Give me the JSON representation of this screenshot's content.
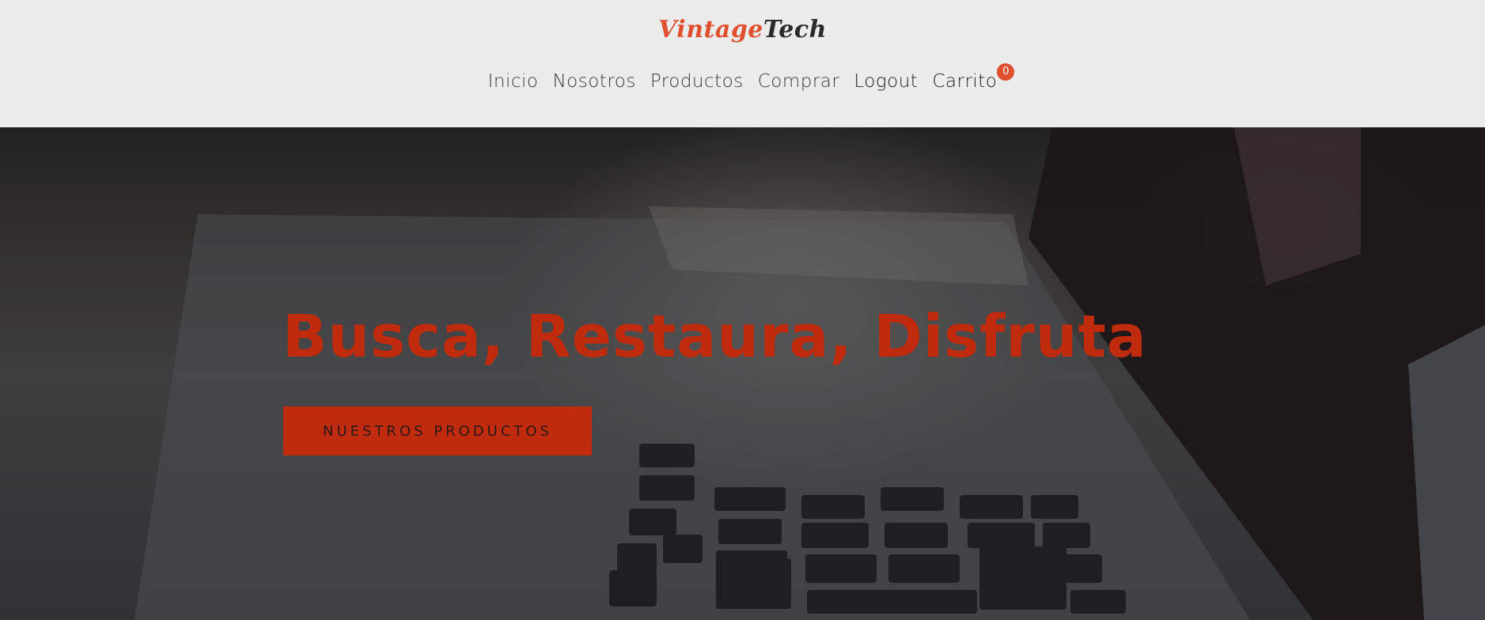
{
  "brand": {
    "part1": "Vintage",
    "part2": "Tech",
    "accent_color": "#e0502e"
  },
  "nav": {
    "items": [
      {
        "label": "Inicio"
      },
      {
        "label": "Nosotros"
      },
      {
        "label": "Productos"
      },
      {
        "label": "Comprar"
      },
      {
        "label": "Logout"
      },
      {
        "label": "Carrito"
      }
    ],
    "cart_count": "0"
  },
  "hero": {
    "title": "Busca, Restaura, Disfruta",
    "button_label": "NUESTROS PRODUCTOS",
    "title_color": "#c02a0d",
    "background_image": "laptop-keyboard-photo"
  }
}
